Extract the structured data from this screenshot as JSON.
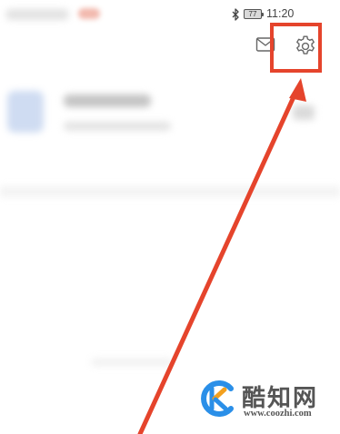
{
  "status_bar": {
    "battery_level": "77",
    "time": "11:20",
    "icons": [
      "bluetooth-icon",
      "battery-icon"
    ]
  },
  "toolbar": {
    "icons": [
      "mail-icon",
      "settings-gear-icon"
    ]
  },
  "annotation": {
    "color": "#e5442c",
    "highlighted_element": "settings-gear-icon"
  },
  "watermark": {
    "title": "酷知网",
    "url": "www.coozhi.com",
    "logo_colors": [
      "#2a8fe8",
      "#f3a01e"
    ]
  }
}
